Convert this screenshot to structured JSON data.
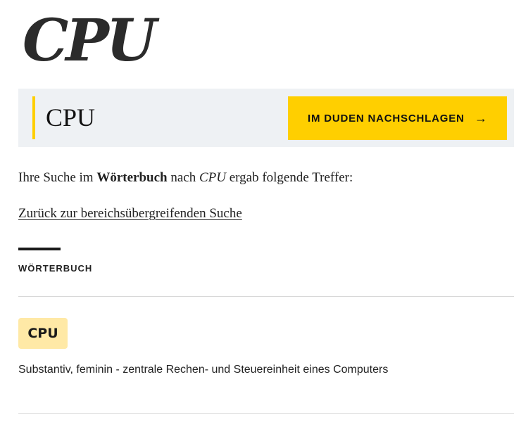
{
  "logo": {
    "text": "CPU"
  },
  "search": {
    "term": "CPU",
    "button_label": "IM DUDEN NACHSCHLAGEN",
    "button_icon": "arrow-right-icon",
    "arrow_glyph": "→"
  },
  "results": {
    "intro_prefix": "Ihre Suche im ",
    "intro_section": "Wörterbuch",
    "intro_middle": " nach ",
    "intro_term": "CPU",
    "intro_suffix": " ergab folgende Treffer:",
    "back_link": "Zurück zur bereichsübergreifenden Suche"
  },
  "section": {
    "title": "WÖRTERBUCH"
  },
  "entries": [
    {
      "word": "CPU",
      "description": "Substantiv, feminin - zentrale Rechen- und Steuereinheit eines Computers"
    }
  ],
  "colors": {
    "accent_yellow": "#ffcf00",
    "chip_yellow": "#ffe9a6",
    "band_gray": "#eef1f4"
  }
}
